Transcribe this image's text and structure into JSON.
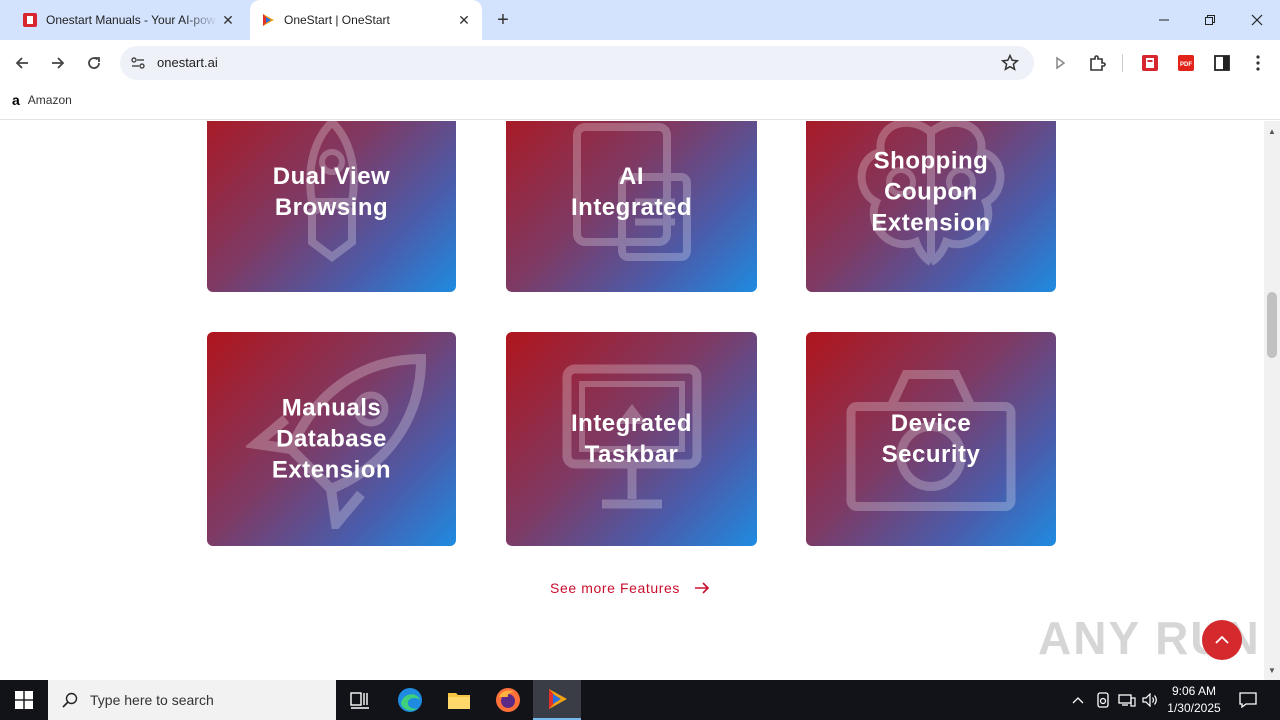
{
  "browser": {
    "tabs": [
      {
        "title": "Onestart Manuals - Your AI-pow",
        "active": false
      },
      {
        "title": "OneStart | OneStart",
        "active": true
      }
    ],
    "url": "onestart.ai",
    "bookmarks": [
      {
        "label": "Amazon"
      }
    ]
  },
  "features": [
    {
      "title": "Dual View\nBrowsing",
      "icon": "rocket-icon"
    },
    {
      "title": "AI\nIntegrated",
      "icon": "document-icon"
    },
    {
      "title": "Shopping\nCoupon\nExtension",
      "icon": "brain-icon"
    },
    {
      "title": "Manuals\nDatabase\nExtension",
      "icon": "rocket-icon"
    },
    {
      "title": "Integrated\nTaskbar",
      "icon": "monitor-icon"
    },
    {
      "title": "Device\nSecurity",
      "icon": "camera-icon"
    }
  ],
  "see_more_label": "See more Features",
  "watermark": "ANY RUN",
  "taskbar": {
    "search_placeholder": "Type here to search",
    "time": "9:06 AM",
    "date": "1/30/2025"
  },
  "colors": {
    "accent": "#c8102e",
    "card_gradient_start": "#b0151c",
    "card_gradient_end": "#1e8be0"
  }
}
